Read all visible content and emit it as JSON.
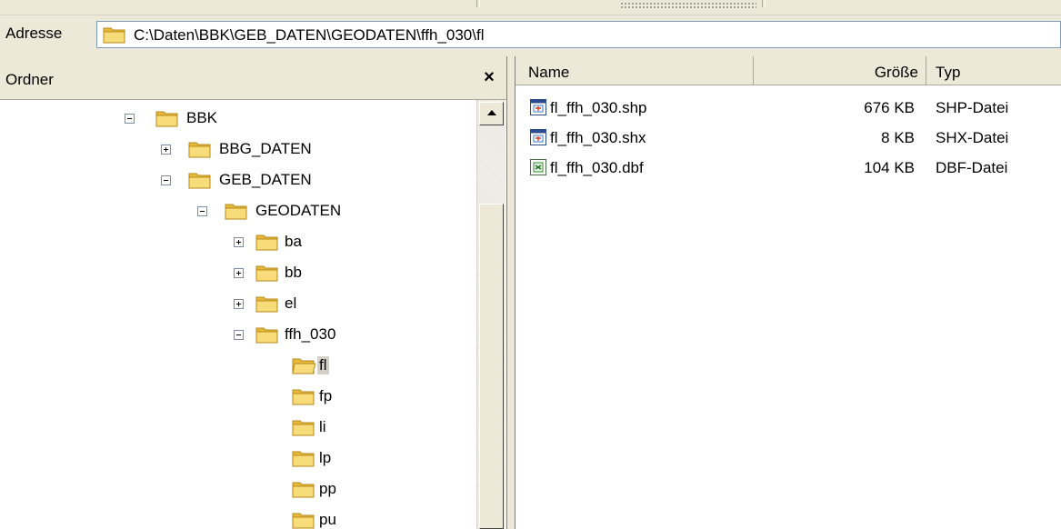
{
  "address": {
    "label": "Adresse",
    "path": "C:\\Daten\\BBK\\GEB_DATEN\\GEODATEN\\ffh_030\\fl"
  },
  "folders_pane": {
    "title": "Ordner",
    "close_symbol": "×",
    "tree": [
      {
        "label": "BBK",
        "state": "expanded"
      },
      {
        "label": "BBG_DATEN",
        "state": "collapsed"
      },
      {
        "label": "GEB_DATEN",
        "state": "expanded"
      },
      {
        "label": "GEODATEN",
        "state": "expanded"
      },
      {
        "label": "ba",
        "state": "collapsed"
      },
      {
        "label": "bb",
        "state": "collapsed"
      },
      {
        "label": "el",
        "state": "collapsed"
      },
      {
        "label": "ffh_030",
        "state": "expanded"
      },
      {
        "label": "fl",
        "state": "leaf",
        "selected": true
      },
      {
        "label": "fp",
        "state": "leaf"
      },
      {
        "label": "li",
        "state": "leaf"
      },
      {
        "label": "lp",
        "state": "leaf"
      },
      {
        "label": "pp",
        "state": "leaf"
      },
      {
        "label": "pu",
        "state": "leaf"
      }
    ]
  },
  "file_list": {
    "columns": {
      "name": "Name",
      "size": "Größe",
      "type": "Typ"
    },
    "files": [
      {
        "name": "fl_ffh_030.shp",
        "size": "676 KB",
        "type": "SHP-Datei",
        "icon": "shp-file-icon"
      },
      {
        "name": "fl_ffh_030.shx",
        "size": "8 KB",
        "type": "SHX-Datei",
        "icon": "shx-file-icon"
      },
      {
        "name": "fl_ffh_030.dbf",
        "size": "104 KB",
        "type": "DBF-Datei",
        "icon": "dbf-file-icon"
      }
    ]
  },
  "colors": {
    "folder": "#f5d56c",
    "selection": "#d4d0c8",
    "chrome": "#ece9d8"
  }
}
